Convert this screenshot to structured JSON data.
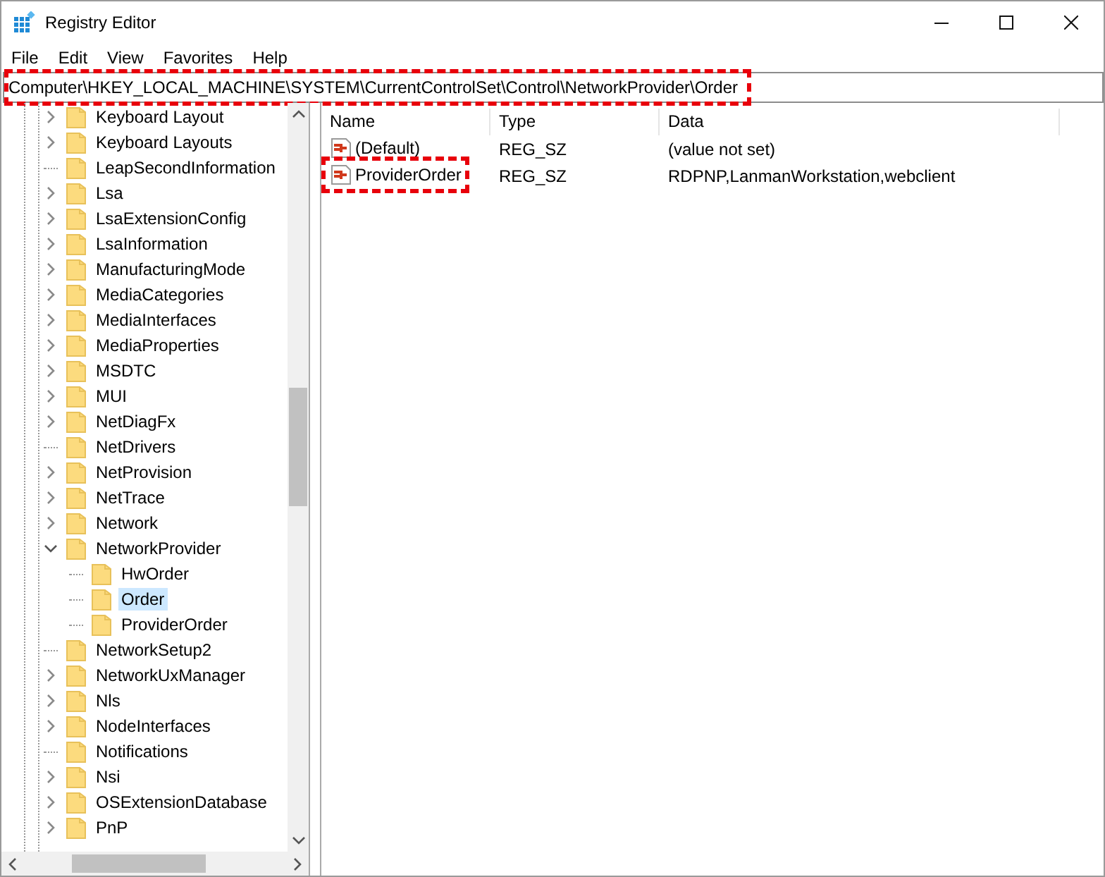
{
  "window": {
    "title": "Registry Editor"
  },
  "menu": [
    "File",
    "Edit",
    "View",
    "Favorites",
    "Help"
  ],
  "address_bar": {
    "value": "Computer\\HKEY_LOCAL_MACHINE\\SYSTEM\\CurrentControlSet\\Control\\NetworkProvider\\Order",
    "highlighted": true
  },
  "tree": [
    {
      "label": "Keyboard Layout",
      "kind": "collapsed",
      "selected": false
    },
    {
      "label": "Keyboard Layouts",
      "kind": "collapsed",
      "selected": false
    },
    {
      "label": "LeapSecondInformation",
      "kind": "leaf",
      "selected": false
    },
    {
      "label": "Lsa",
      "kind": "collapsed",
      "selected": false
    },
    {
      "label": "LsaExtensionConfig",
      "kind": "collapsed",
      "selected": false
    },
    {
      "label": "LsaInformation",
      "kind": "collapsed",
      "selected": false
    },
    {
      "label": "ManufacturingMode",
      "kind": "collapsed",
      "selected": false
    },
    {
      "label": "MediaCategories",
      "kind": "collapsed",
      "selected": false
    },
    {
      "label": "MediaInterfaces",
      "kind": "collapsed",
      "selected": false
    },
    {
      "label": "MediaProperties",
      "kind": "collapsed",
      "selected": false
    },
    {
      "label": "MSDTC",
      "kind": "collapsed",
      "selected": false
    },
    {
      "label": "MUI",
      "kind": "collapsed",
      "selected": false
    },
    {
      "label": "NetDiagFx",
      "kind": "collapsed",
      "selected": false
    },
    {
      "label": "NetDrivers",
      "kind": "leaf",
      "selected": false
    },
    {
      "label": "NetProvision",
      "kind": "collapsed",
      "selected": false
    },
    {
      "label": "NetTrace",
      "kind": "collapsed",
      "selected": false
    },
    {
      "label": "Network",
      "kind": "collapsed",
      "selected": false
    },
    {
      "label": "NetworkProvider",
      "kind": "expanded",
      "selected": false,
      "children": [
        {
          "label": "HwOrder",
          "kind": "leaf",
          "selected": false
        },
        {
          "label": "Order",
          "kind": "leaf",
          "selected": true
        },
        {
          "label": "ProviderOrder",
          "kind": "leaf",
          "selected": false
        }
      ]
    },
    {
      "label": "NetworkSetup2",
      "kind": "leaf",
      "selected": false
    },
    {
      "label": "NetworkUxManager",
      "kind": "collapsed",
      "selected": false
    },
    {
      "label": "Nls",
      "kind": "collapsed",
      "selected": false
    },
    {
      "label": "NodeInterfaces",
      "kind": "collapsed",
      "selected": false
    },
    {
      "label": "Notifications",
      "kind": "leaf",
      "selected": false
    },
    {
      "label": "Nsi",
      "kind": "collapsed",
      "selected": false
    },
    {
      "label": "OSExtensionDatabase",
      "kind": "collapsed",
      "selected": false
    },
    {
      "label": "PnP",
      "kind": "collapsed",
      "selected": false
    }
  ],
  "table": {
    "columns": [
      "Name",
      "Type",
      "Data"
    ],
    "rows": [
      {
        "name": "(Default)",
        "type": "REG_SZ",
        "data": "(value not set)",
        "highlighted": false
      },
      {
        "name": "ProviderOrder",
        "type": "REG_SZ",
        "data": "RDPNP,LanmanWorkstation,webclient",
        "highlighted": true
      }
    ]
  }
}
